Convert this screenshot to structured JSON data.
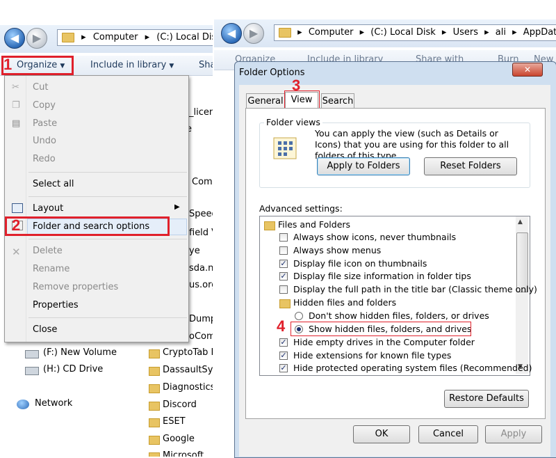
{
  "left": {
    "address": {
      "path": [
        "Computer",
        "(C:) Local Disk"
      ]
    },
    "toolbar": {
      "organize": "Organize",
      "include": "Include in library",
      "share": "Sha"
    },
    "step1": "1",
    "step2": "2",
    "menu": {
      "cut": "Cut",
      "copy": "Copy",
      "paste": "Paste",
      "undo": "Undo",
      "redo": "Redo",
      "select_all": "Select all",
      "layout": "Layout",
      "folder_options": "Folder and search options",
      "delete": "Delete",
      "rename": "Rename",
      "remove_props": "Remove properties",
      "properties": "Properties",
      "close": "Close"
    },
    "peek": [
      "_licen",
      "e",
      "Comp",
      "Speedu",
      "field V",
      "ye",
      "sda.ne",
      "us.org",
      "Dump",
      "oCom"
    ],
    "nav": {
      "f_drive": "(F:) New Volume",
      "h_drive": "(H:) CD Drive",
      "network": "Network"
    },
    "folders": [
      "CryptoTab E",
      "DassaultSys",
      "Diagnostics",
      "Discord",
      "ESET",
      "Google",
      "Microsoft"
    ]
  },
  "right": {
    "address": {
      "path": [
        "Computer",
        "(C:) Local Disk",
        "Users",
        "ali",
        "AppDat"
      ]
    },
    "toolbar_ghost": [
      "Organize",
      "Include in library",
      "Share with",
      "Burn",
      "New fol"
    ],
    "dialog": {
      "title": "Folder Options",
      "close_glyph": "✕",
      "step3": "3",
      "step4": "4",
      "tabs": [
        "General",
        "View",
        "Search"
      ],
      "folder_views": {
        "legend": "Folder views",
        "text": "You can apply the view (such as Details or Icons) that you are using for this folder to all folders of this type.",
        "apply": "Apply to Folders",
        "reset": "Reset Folders"
      },
      "advanced_label": "Advanced settings:",
      "items": [
        {
          "type": "folder",
          "text": "Files and Folders"
        },
        {
          "type": "check",
          "checked": false,
          "text": "Always show icons, never thumbnails"
        },
        {
          "type": "check",
          "checked": false,
          "text": "Always show menus"
        },
        {
          "type": "check",
          "checked": true,
          "text": "Display file icon on thumbnails"
        },
        {
          "type": "check",
          "checked": true,
          "text": "Display file size information in folder tips"
        },
        {
          "type": "check",
          "checked": false,
          "text": "Display the full path in the title bar (Classic theme only)"
        },
        {
          "type": "folder",
          "text": "Hidden files and folders"
        },
        {
          "type": "radio",
          "checked": false,
          "text": "Don't show hidden files, folders, or drives"
        },
        {
          "type": "radio",
          "checked": true,
          "text": "Show hidden files, folders, and drives"
        },
        {
          "type": "check",
          "checked": true,
          "text": "Hide empty drives in the Computer folder"
        },
        {
          "type": "check",
          "checked": true,
          "text": "Hide extensions for known file types"
        },
        {
          "type": "check",
          "checked": true,
          "text": "Hide protected operating system files (Recommended)"
        }
      ],
      "restore": "Restore Defaults",
      "ok": "OK",
      "cancel": "Cancel",
      "apply_btn": "Apply"
    }
  },
  "colors": {
    "callout_red": "#e0202b",
    "explorer_blue": "#1e395b"
  }
}
